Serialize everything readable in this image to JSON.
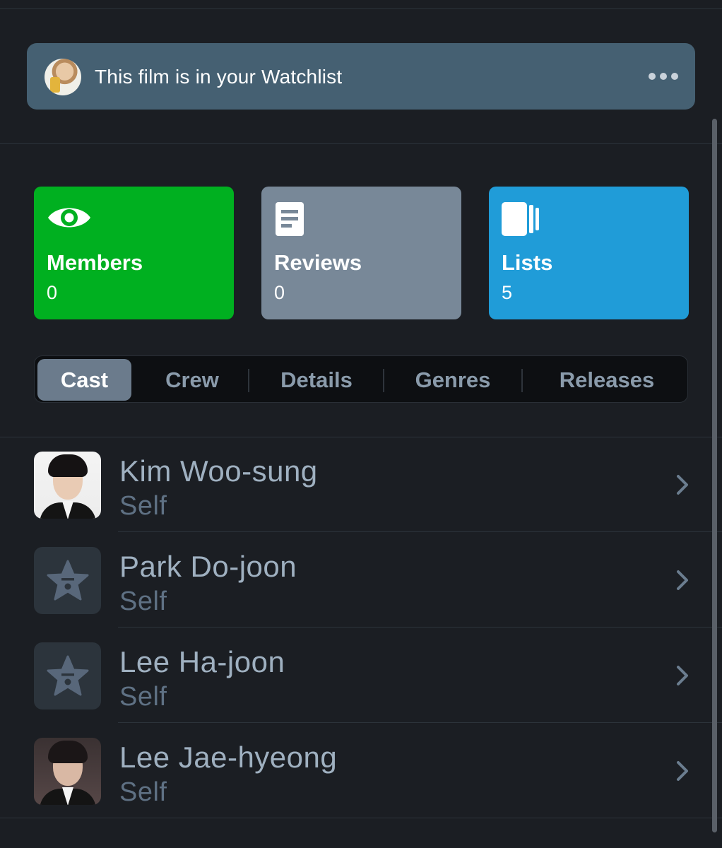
{
  "banner": {
    "text": "This film is in your Watchlist",
    "avatar_icon": "user-avatar",
    "more_icon": "ellipsis-icon"
  },
  "stats": [
    {
      "label": "Members",
      "count": "0",
      "icon": "eye-icon",
      "color": "#00b020"
    },
    {
      "label": "Reviews",
      "count": "0",
      "icon": "document-icon",
      "color": "#788898"
    },
    {
      "label": "Lists",
      "count": "5",
      "icon": "lists-icon",
      "color": "#209cd8"
    }
  ],
  "tabs": [
    {
      "label": "Cast",
      "active": true
    },
    {
      "label": "Crew",
      "active": false
    },
    {
      "label": "Details",
      "active": false
    },
    {
      "label": "Genres",
      "active": false
    },
    {
      "label": "Releases",
      "active": false
    }
  ],
  "cast": [
    {
      "name": "Kim Woo-sung",
      "role": "Self",
      "avatar": "photo"
    },
    {
      "name": "Park Do-joon",
      "role": "Self",
      "avatar": "star-placeholder-icon"
    },
    {
      "name": "Lee Ha-joon",
      "role": "Self",
      "avatar": "star-placeholder-icon"
    },
    {
      "name": "Lee Jae-hyeong",
      "role": "Self",
      "avatar": "photo"
    }
  ],
  "colors": {
    "background": "#1b1e23",
    "banner": "#456072",
    "active_tab": "#6b7b8c",
    "name_text": "#9fb0c0",
    "role_text": "#5f7184"
  }
}
